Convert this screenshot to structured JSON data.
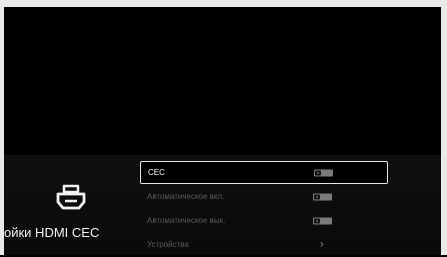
{
  "panel": {
    "title": "ойки HDMI CEC",
    "icon": "hdmi-icon"
  },
  "menu": {
    "items": [
      {
        "label": "CEC",
        "control": "toggle",
        "state": "off",
        "focused": true,
        "enabled": true
      },
      {
        "label": "Автоматическое вкл.",
        "control": "toggle",
        "state": "off",
        "focused": false,
        "enabled": false
      },
      {
        "label": "Автоматическое вык.",
        "control": "toggle",
        "state": "off",
        "focused": false,
        "enabled": false
      },
      {
        "label": "Устройства",
        "control": "chevron",
        "focused": false,
        "enabled": false
      }
    ]
  },
  "colors": {
    "background": "#000000",
    "frame": "#e9e9e9",
    "focus_border": "#e6e6e6",
    "disabled_text": "#5a5a5a",
    "toggle_off": "#7b7b7b"
  }
}
